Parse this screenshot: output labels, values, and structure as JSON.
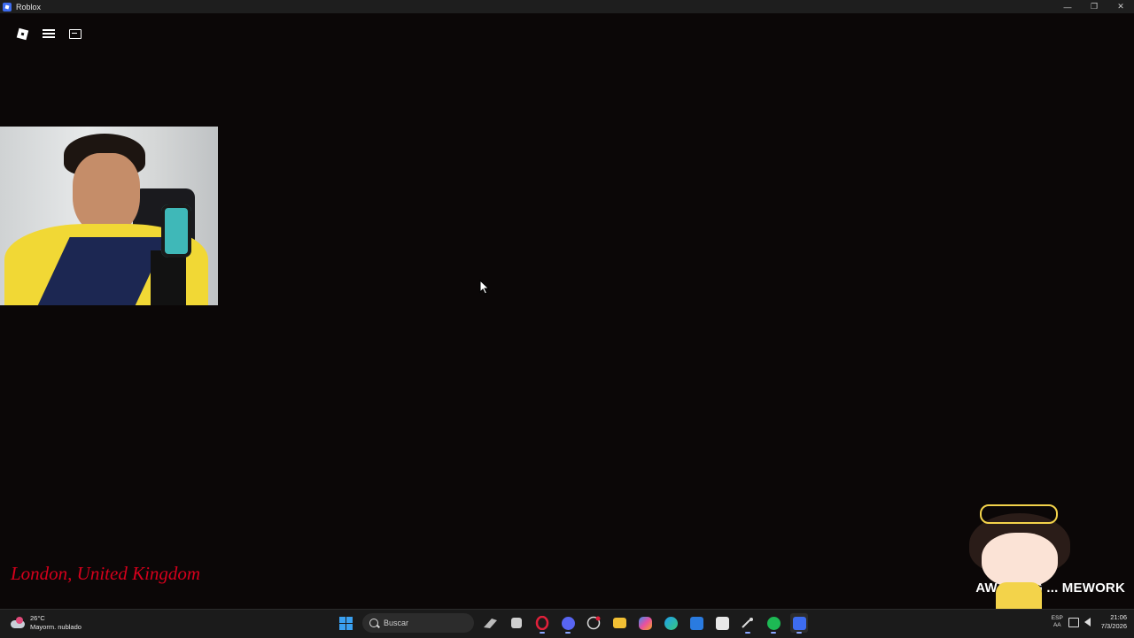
{
  "window": {
    "title": "Roblox",
    "controls": [
      "minimize",
      "restore",
      "close"
    ],
    "minimize_glyph": "—",
    "restore_glyph": "❐",
    "close_glyph": "✕"
  },
  "roblox_menu": {
    "items": [
      {
        "icon": "roblox-logo-icon"
      },
      {
        "icon": "menu-icon"
      },
      {
        "icon": "chat-icon"
      }
    ]
  },
  "overlay": {
    "location_text": "London, United Kingdom",
    "awaiting_text": "AWAITING ... MEWORK",
    "location_color": "#d6001c"
  },
  "taskbar": {
    "weather": {
      "temp": "26°C",
      "condition": "Mayorm. nublado"
    },
    "search_placeholder": "Buscar",
    "apps": [
      "start-icon",
      "search",
      "scroll-icon",
      "taskview-icon",
      "opera-icon",
      "discord-icon",
      "github-icon",
      "file-explorer-icon",
      "copilot-icon",
      "edge-icon",
      "mail-icon",
      "store-icon",
      "steam-icon",
      "spotify-icon",
      "roblox-icon"
    ],
    "tray": {
      "lang_top": "ESP",
      "lang_bottom": "AA"
    },
    "clock": {
      "time": "21:06",
      "date": "7/3/2026"
    }
  },
  "colors": {
    "background": "#0b0707",
    "taskbar": "#1b1b1b",
    "accent": "#3aa0f0"
  }
}
